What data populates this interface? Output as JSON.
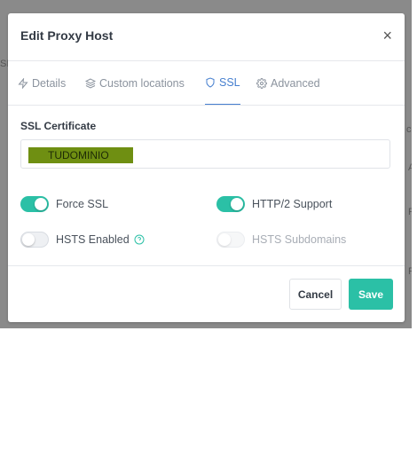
{
  "modal": {
    "title": "Edit Proxy Host",
    "close_glyph": "×"
  },
  "tabs": [
    {
      "label": "Details",
      "icon": "zap-icon",
      "active": false
    },
    {
      "label": "Custom locations",
      "icon": "layers-icon",
      "active": false
    },
    {
      "label": "SSL",
      "icon": "shield-icon",
      "active": true
    },
    {
      "label": "Advanced",
      "icon": "gear-icon",
      "active": false
    }
  ],
  "ssl": {
    "certificate_label": "SSL Certificate",
    "certificate_value": "TUDOMINIO",
    "certificate_highlight": "#6f8f12"
  },
  "toggles": {
    "force_ssl": {
      "label": "Force SSL",
      "on": true,
      "disabled": false
    },
    "http2": {
      "label": "HTTP/2 Support",
      "on": true,
      "disabled": false
    },
    "hsts": {
      "label": "HSTS Enabled",
      "on": false,
      "disabled": false
    },
    "hsts_subdomains": {
      "label": "HSTS Subdomains",
      "on": false,
      "disabled": true
    }
  },
  "footer": {
    "cancel_label": "Cancel",
    "save_label": "Save"
  },
  "colors": {
    "accent": "#2bc0a6",
    "active_tab": "#467fcf"
  }
}
